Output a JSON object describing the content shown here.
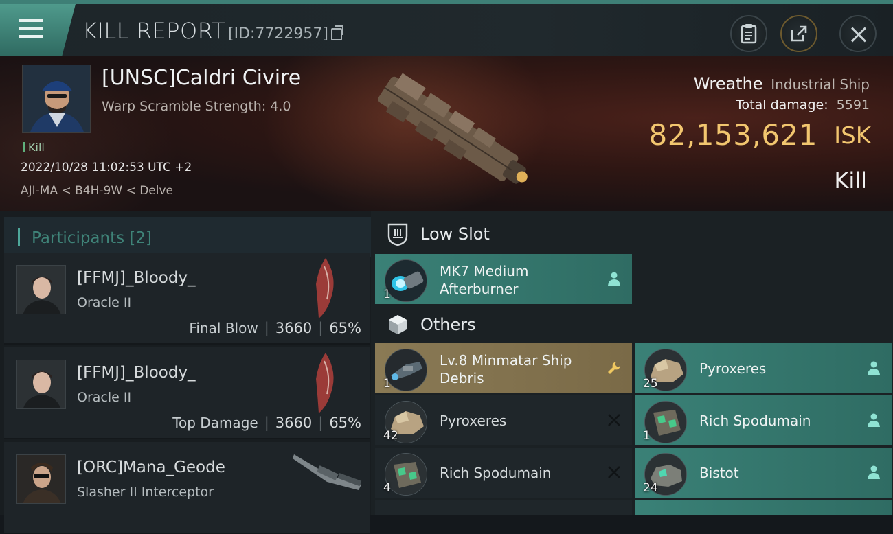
{
  "header": {
    "title": "KILL REPORT",
    "id_label": "[ID:7722957]"
  },
  "victim": {
    "name": "[UNSC]Caldri Civire",
    "scramble": "Warp Scramble Strength: 4.0",
    "tag": "Kill",
    "time": "2022/10/28 11:02:53 UTC +2",
    "location": "AJI-MA < B4H-9W < Delve",
    "ship_name": "Wreathe",
    "ship_class": "Industrial Ship",
    "damage_label": "Total damage:",
    "damage_value": "5591",
    "isk_value": "82,153,621",
    "isk_unit": "ISK",
    "result": "Kill"
  },
  "participants": {
    "title": "Participants [2]",
    "items": [
      {
        "name": "[FFMJ]_Bloody_",
        "ship": "Oracle II",
        "label": "Final Blow",
        "damage": "3660",
        "percent": "65%"
      },
      {
        "name": "[FFMJ]_Bloody_",
        "ship": "Oracle II",
        "label": "Top Damage",
        "damage": "3660",
        "percent": "65%"
      },
      {
        "name": "[ORC]Mana_Geode",
        "ship": "Slasher II Interceptor",
        "label": "",
        "damage": "",
        "percent": ""
      }
    ]
  },
  "sections": {
    "low_slot": "Low Slot",
    "others": "Others"
  },
  "items": {
    "afterburner": {
      "line1": "MK7 Medium",
      "line2": "Afterburner",
      "qty": "1"
    },
    "debris": {
      "line1": "Lv.8 Minmatar Ship",
      "line2": "Debris",
      "qty": "1"
    },
    "pyroxeres_dropped": {
      "name": "Pyroxeres",
      "qty": "25"
    },
    "pyroxeres_destroyed": {
      "name": "Pyroxeres",
      "qty": "42"
    },
    "spodumain_dropped": {
      "name": "Rich Spodumain",
      "qty": "1"
    },
    "spodumain_destroyed": {
      "name": "Rich Spodumain",
      "qty": "4"
    },
    "bistot_dropped": {
      "name": "Bistot",
      "qty": "24"
    }
  },
  "colors": {
    "accent_teal": "#3a8177",
    "gold": "#f2c66f",
    "gold_item": "#8a7a55"
  }
}
